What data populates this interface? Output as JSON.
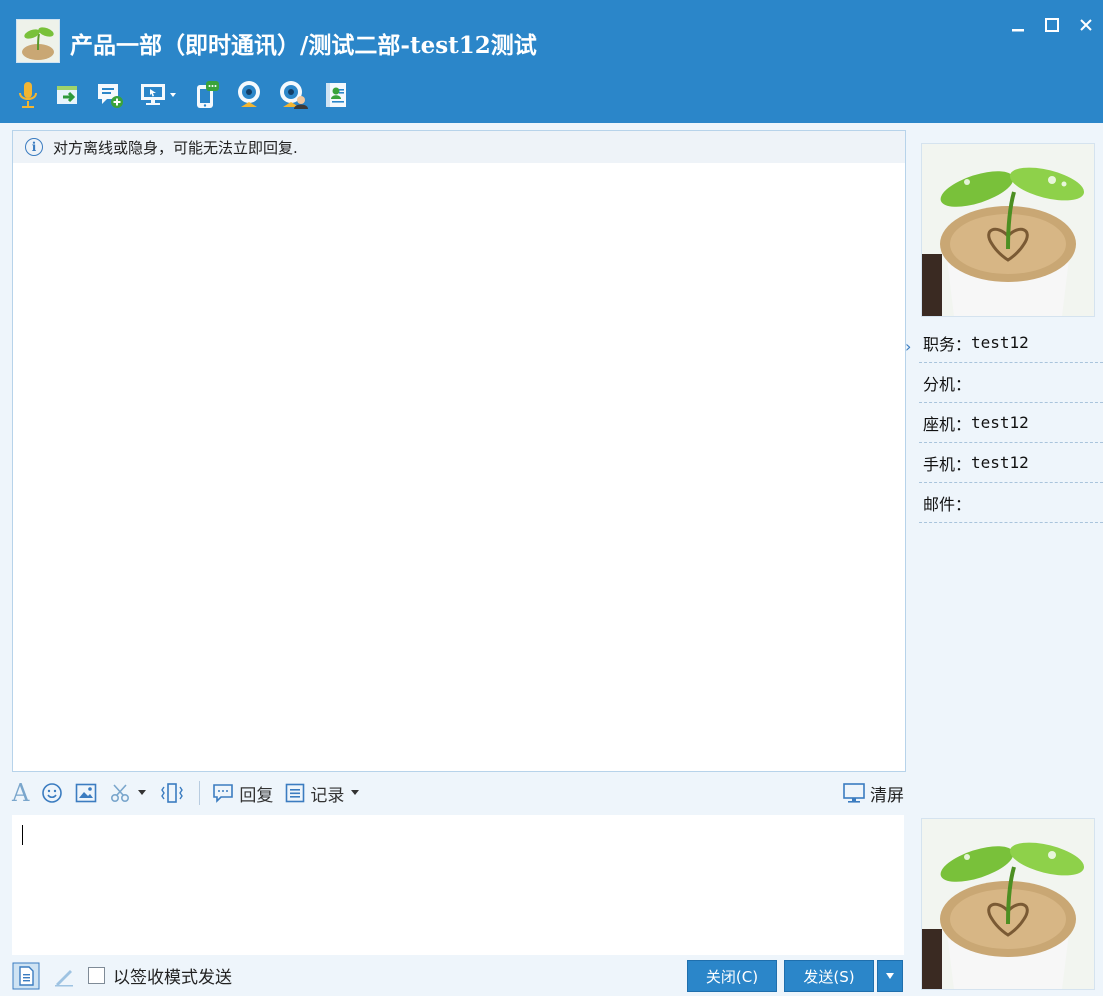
{
  "window": {
    "title": "产品一部（即时通讯）/测试二部-test12测试",
    "minimize": "_",
    "maximize": "☐",
    "close": "×"
  },
  "toolbar": {
    "icons": [
      "microphone-icon",
      "file-transfer-icon",
      "new-message-icon",
      "screen-share-icon",
      "mobile-sms-icon",
      "webcam-icon",
      "video-call-icon",
      "contact-card-icon"
    ]
  },
  "notice": {
    "text": "对方离线或隐身，可能无法立即回复."
  },
  "input_toolbar": {
    "font_glyph": "A",
    "reply_label": "回复",
    "history_label": "记录",
    "clear_label": "清屏"
  },
  "bottom": {
    "receipt_mode_label": "以签收模式发送",
    "close_button": "关闭(C)",
    "send_button": "发送(S)"
  },
  "contact_info": {
    "position_label": "职务：",
    "position_value": "test12",
    "extension_label": "分机：",
    "extension_value": "",
    "landline_label": "座机：",
    "landline_value": "test12",
    "mobile_label": "手机：",
    "mobile_value": "test12",
    "email_label": "邮件：",
    "email_value": ""
  },
  "colors": {
    "accent": "#2b86c9",
    "panel_bg": "#eef5fb",
    "border": "#b7d3ea"
  }
}
